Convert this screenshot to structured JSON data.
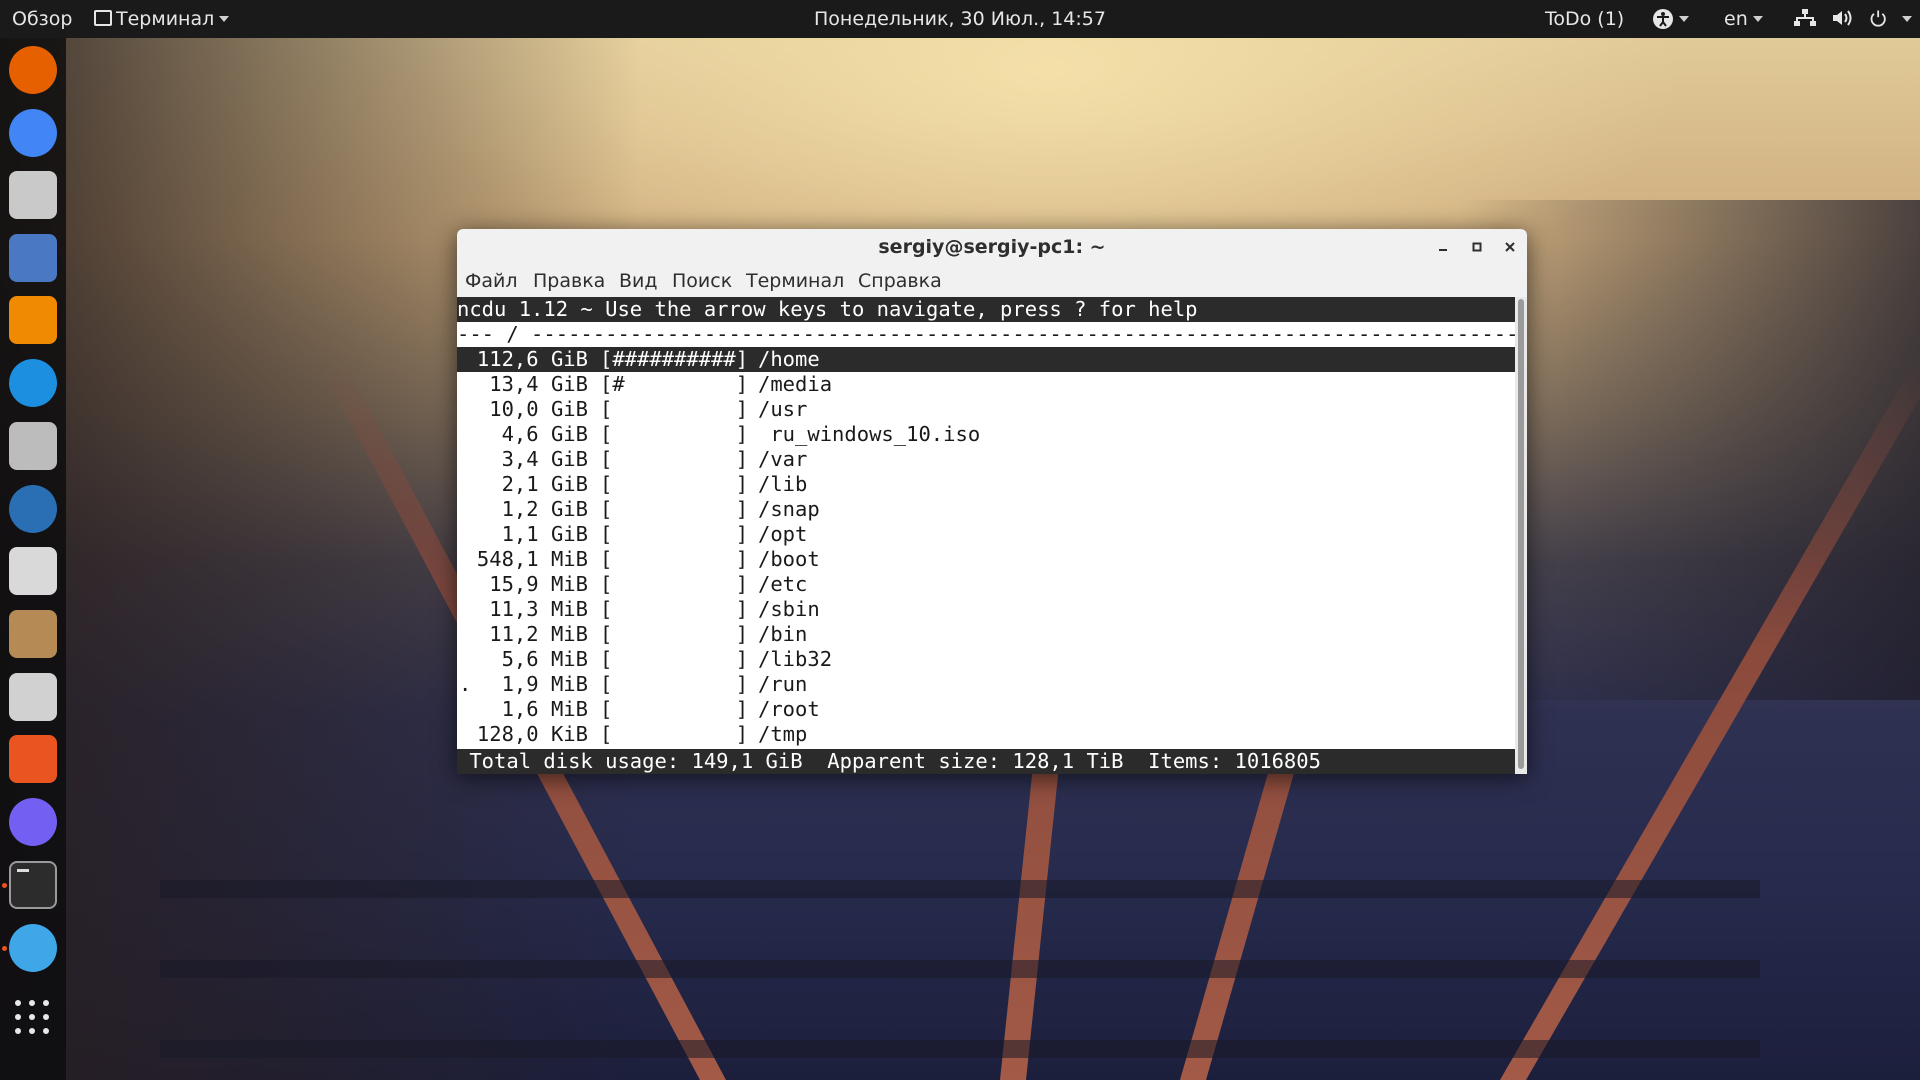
{
  "topbar": {
    "activities": "Обзор",
    "app_menu": "Терминал",
    "clock": "Понедельник, 30 Июл., 14:57",
    "todo": "ToDo (1)",
    "language": "en"
  },
  "dock": {
    "apps": [
      {
        "name": "firefox-icon",
        "color": "#e66000"
      },
      {
        "name": "chrome-icon",
        "color": "#4285f4"
      },
      {
        "name": "speaker-app-icon",
        "color": "#c9c9c9"
      },
      {
        "name": "file-cabinet-icon",
        "color": "#4a78c2"
      },
      {
        "name": "vlc-icon",
        "color": "#f08a00"
      },
      {
        "name": "skype-icon",
        "color": "#1d8fe0"
      },
      {
        "name": "tools-icon",
        "color": "#bcbcbc"
      },
      {
        "name": "thunderbird-icon",
        "color": "#2a6fb4"
      },
      {
        "name": "calculator-icon",
        "color": "#d9d9d9"
      },
      {
        "name": "archive-manager-icon",
        "color": "#b58a54"
      },
      {
        "name": "usb-creator-icon",
        "color": "#d1d1d1"
      },
      {
        "name": "software-center-icon",
        "color": "#e95420"
      },
      {
        "name": "viber-icon",
        "color": "#7360f2"
      },
      {
        "name": "terminal-icon",
        "color": "#2c2c2c"
      },
      {
        "name": "settings-splash-icon",
        "color": "#3fa7e8"
      }
    ]
  },
  "window": {
    "title": "sergiy@sergiy-pc1: ~",
    "menu": [
      "Файл",
      "Правка",
      "Вид",
      "Поиск",
      "Терминал",
      "Справка"
    ]
  },
  "terminal": {
    "header": "ncdu 1.12 ~ Use the arrow keys to navigate, press ? for help",
    "separator": "--- / ---------------------------------------------------------------------------------------",
    "entries": [
      {
        "mark": "",
        "size": "112,6 GiB",
        "bar": "[##########]",
        "name": "/home"
      },
      {
        "mark": "",
        "size": "13,4 GiB",
        "bar": "[#         ]",
        "name": "/media"
      },
      {
        "mark": "",
        "size": "10,0 GiB",
        "bar": "[          ]",
        "name": "/usr"
      },
      {
        "mark": "",
        "size": "4,6 GiB",
        "bar": "[          ]",
        "name": " ru_windows_10.iso"
      },
      {
        "mark": "",
        "size": "3,4 GiB",
        "bar": "[          ]",
        "name": "/var"
      },
      {
        "mark": "",
        "size": "2,1 GiB",
        "bar": "[          ]",
        "name": "/lib"
      },
      {
        "mark": "",
        "size": "1,2 GiB",
        "bar": "[          ]",
        "name": "/snap"
      },
      {
        "mark": "",
        "size": "1,1 GiB",
        "bar": "[          ]",
        "name": "/opt"
      },
      {
        "mark": "",
        "size": "548,1 MiB",
        "bar": "[          ]",
        "name": "/boot"
      },
      {
        "mark": "",
        "size": "15,9 MiB",
        "bar": "[          ]",
        "name": "/etc"
      },
      {
        "mark": "",
        "size": "11,3 MiB",
        "bar": "[          ]",
        "name": "/sbin"
      },
      {
        "mark": "",
        "size": "11,2 MiB",
        "bar": "[          ]",
        "name": "/bin"
      },
      {
        "mark": "",
        "size": "5,6 MiB",
        "bar": "[          ]",
        "name": "/lib32"
      },
      {
        "mark": ".",
        "size": "1,9 MiB",
        "bar": "[          ]",
        "name": "/run"
      },
      {
        "mark": "",
        "size": "1,6 MiB",
        "bar": "[          ]",
        "name": "/root"
      },
      {
        "mark": "",
        "size": "128,0 KiB",
        "bar": "[          ]",
        "name": "/tmp"
      }
    ],
    "status": " Total disk usage: 149,1 GiB  Apparent size: 128,1 TiB  Items: 1016805"
  },
  "colors": {
    "topbar": "#1a1a1a",
    "highlight": "#2b2b2b",
    "ubuntu_orange": "#e95420"
  }
}
